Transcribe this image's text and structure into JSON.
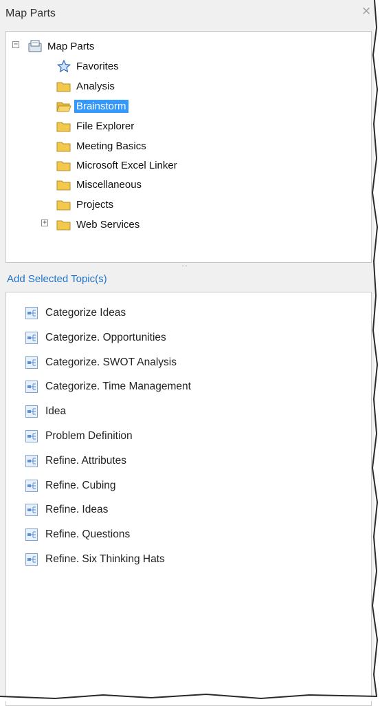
{
  "panel": {
    "title": "Map Parts",
    "close_glyph": "×"
  },
  "tree": {
    "root": {
      "label": "Map Parts",
      "expander": "−",
      "icon": "map-parts-root-icon"
    },
    "items": [
      {
        "label": "Favorites",
        "icon": "star-icon"
      },
      {
        "label": "Analysis",
        "icon": "folder-icon"
      },
      {
        "label": "Brainstorm",
        "icon": "folder-open-icon",
        "selected": true
      },
      {
        "label": "File Explorer",
        "icon": "folder-icon"
      },
      {
        "label": "Meeting Basics",
        "icon": "folder-icon"
      },
      {
        "label": "Microsoft Excel Linker",
        "icon": "folder-icon"
      },
      {
        "label": "Miscellaneous",
        "icon": "folder-icon"
      },
      {
        "label": "Projects",
        "icon": "folder-icon"
      },
      {
        "label": "Web Services",
        "icon": "folder-icon",
        "expander": "+"
      }
    ]
  },
  "add_selected_label": "Add Selected Topic(s)",
  "topics": [
    {
      "label": "Categorize Ideas"
    },
    {
      "label": "Categorize. Opportunities"
    },
    {
      "label": "Categorize. SWOT Analysis"
    },
    {
      "label": "Categorize. Time Management"
    },
    {
      "label": "Idea"
    },
    {
      "label": "Problem Definition"
    },
    {
      "label": "Refine. Attributes"
    },
    {
      "label": "Refine. Cubing"
    },
    {
      "label": "Refine. Ideas"
    },
    {
      "label": "Refine. Questions"
    },
    {
      "label": "Refine. Six Thinking Hats"
    }
  ],
  "colors": {
    "accent": "#3399ff",
    "link": "#1e74c8",
    "folder": "#f2c94c"
  }
}
